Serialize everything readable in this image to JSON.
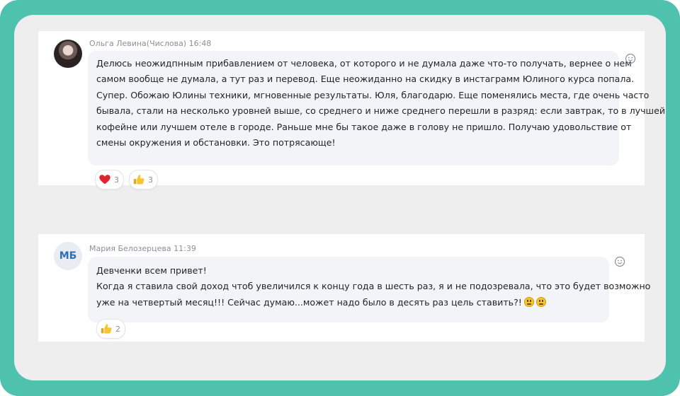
{
  "messages": [
    {
      "author": "Ольга Левина(Числова)",
      "time": "16:48",
      "lines": [
        "Делюсь неожидпнным прибавлением от человека, от которого и не думала даже что-то получать, вернее о нем",
        "самом вообще не думала, а тут раз и перевод. Еще неожиданно на скидку в инстаграмм Юлиного курса попала.",
        "Супер. Обожаю Юлины техники, мгновенные результаты. Юля, благодарю. Еще поменялись места, где очень часто",
        "бывала, стали на несколько уровней выше, со среднего и ниже среднего перешли в разряд: если завтрак, то в лучшей",
        "кофейне или лучшем отеле в городе. Раньше мне бы такое даже в голову не пришло. Получаю удовольствие от",
        "смены окружения и обстановки. Это потрясающе!"
      ],
      "reactions": [
        {
          "icon": "heart-icon",
          "count": "3"
        },
        {
          "icon": "thumbs-up-icon",
          "count": "3"
        }
      ]
    },
    {
      "author": "Мария Белозерцева",
      "time": "11:39",
      "initials": "МБ",
      "lines": [
        "Девченки всем привет!",
        "Когда я ставила свой доход чтоб увеличился к концу года в шесть раз, я и не подозревала, что это будет возможно",
        "уже на четвертый месяц!!! Сейчас думаю...может надо было в десять раз цель ставить?!"
      ],
      "reactions": [
        {
          "icon": "thumbs-up-icon",
          "count": "2"
        }
      ]
    }
  ],
  "colors": {
    "frame": "#4fc2ae",
    "background": "#eeeeee",
    "bubble": "#f2f4f8",
    "initials": "#2e6fb8"
  }
}
